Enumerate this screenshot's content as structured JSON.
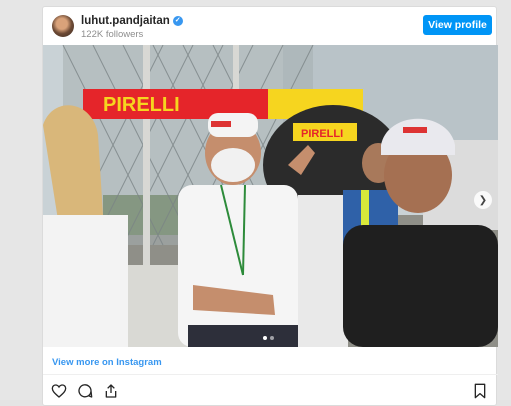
{
  "profile": {
    "username": "luhut.pandjaitan",
    "followers": "122K followers",
    "view_profile_label": "View profile"
  },
  "photo": {
    "banner_brand": "PIRELLI",
    "badge_brand": "PIRELLI"
  },
  "footer": {
    "view_more_label": "View more on Instagram"
  },
  "icons": {
    "verified": "verified-badge-icon",
    "like": "heart-icon",
    "comment": "comment-icon",
    "share": "share-icon",
    "save": "bookmark-icon",
    "next": "chevron-right-icon"
  },
  "colors": {
    "accent": "#0095f6",
    "link": "#3897f0",
    "text": "#262626",
    "muted": "#8e8e8e"
  }
}
